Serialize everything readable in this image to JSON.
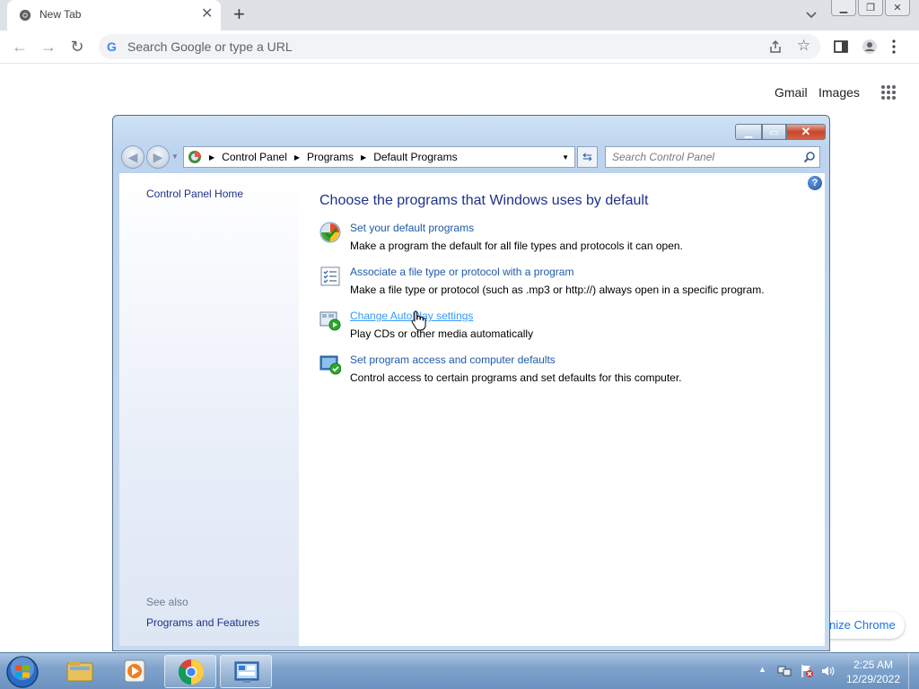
{
  "browser": {
    "tab_title": "New Tab",
    "tab_close_glyph": "✕",
    "new_tab_glyph": "+",
    "omnibox_placeholder": "Search Google or type a URL",
    "omnibox_g": "G",
    "ntp_links": {
      "gmail": "Gmail",
      "images": "Images"
    },
    "customize_label": "nize Chrome",
    "icons": [
      "chrome-icon",
      "close-icon",
      "plus-icon",
      "tab-search-icon",
      "back-icon",
      "forward-icon",
      "reload-icon",
      "share-icon",
      "star-icon",
      "side-panel-icon",
      "profile-icon",
      "menu-icon",
      "apps-grid-icon"
    ]
  },
  "window": {
    "breadcrumb": [
      "Control Panel",
      "Programs",
      "Default Programs"
    ],
    "search_placeholder": "Search Control Panel",
    "help_glyph": "?",
    "left_pane": {
      "home": "Control Panel Home",
      "see_also": "See also",
      "programs_and_features": "Programs and Features"
    },
    "heading": "Choose the programs that Windows uses by default",
    "tasks": [
      {
        "icon": "default-programs-icon",
        "link": "Set your default programs",
        "desc": "Make a program the default for all file types and protocols it can open."
      },
      {
        "icon": "file-association-icon",
        "link": "Associate a file type or protocol with a program",
        "desc": "Make a file type or protocol (such as .mp3 or http://) always open in a specific program."
      },
      {
        "icon": "autoplay-icon",
        "link": "Change AutoPlay settings",
        "desc": "Play CDs or other media automatically"
      },
      {
        "icon": "program-access-icon",
        "link": "Set program access and computer defaults",
        "desc": "Control access to certain programs and set defaults for this computer."
      }
    ]
  },
  "taskbar": {
    "apps": [
      "explorer-icon",
      "media-player-icon",
      "chrome-icon",
      "control-panel-icon"
    ],
    "time": "2:25 AM",
    "date": "12/29/2022"
  },
  "colors": {
    "link": "#1e5aa8",
    "heading": "#1e3287",
    "link_hover": "#3399ff"
  }
}
